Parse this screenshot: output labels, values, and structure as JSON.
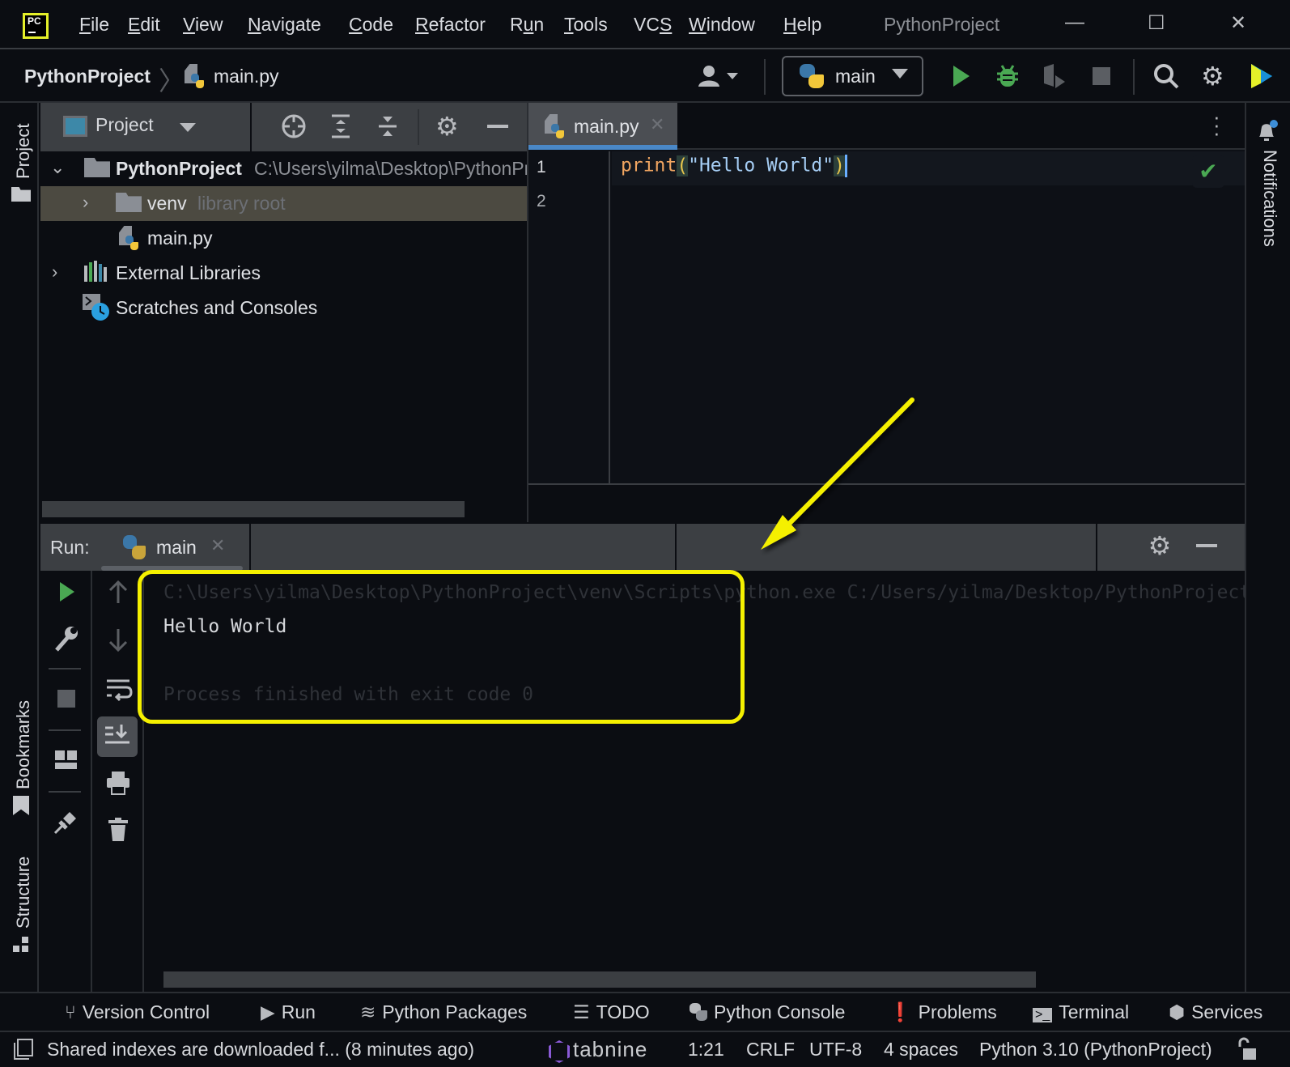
{
  "app": {
    "window_title": "PythonProject",
    "menu": [
      {
        "label": "File",
        "mnemonic": "F"
      },
      {
        "label": "Edit",
        "mnemonic": "E"
      },
      {
        "label": "View",
        "mnemonic": "V"
      },
      {
        "label": "Navigate",
        "mnemonic": "N"
      },
      {
        "label": "Code",
        "mnemonic": "C"
      },
      {
        "label": "Refactor",
        "mnemonic": "R"
      },
      {
        "label": "Run",
        "mnemonic": "u"
      },
      {
        "label": "Tools",
        "mnemonic": "T"
      },
      {
        "label": "VCS",
        "mnemonic": "S"
      },
      {
        "label": "Window",
        "mnemonic": "W"
      },
      {
        "label": "Help",
        "mnemonic": "H"
      }
    ],
    "window_controls": {
      "minimize": "—",
      "maximize": "☐",
      "close": "✕"
    }
  },
  "navbar": {
    "breadcrumb": [
      "PythonProject",
      "main.py"
    ],
    "run_config": "main",
    "icons": [
      "user-icon",
      "run-icon",
      "debug-icon",
      "coverage-icon",
      "stop-icon",
      "search-icon",
      "settings-icon",
      "jetbrains-icon"
    ]
  },
  "left_strip": {
    "top": [
      {
        "label": "Project",
        "icon": "folder-icon"
      }
    ],
    "bottom": [
      {
        "label": "Bookmarks",
        "icon": "bookmark-icon"
      },
      {
        "label": "Structure",
        "icon": "structure-icon"
      }
    ]
  },
  "project_panel": {
    "title": "Project",
    "tree": [
      {
        "label": "PythonProject",
        "sub": "C:\\Users\\yilma\\Desktop\\PythonProject",
        "expanded": true,
        "icon": "folder-icon",
        "bold": true
      },
      {
        "label": "venv",
        "sub": "library root",
        "expanded": false,
        "icon": "folder-icon",
        "selected": true
      },
      {
        "label": "main.py",
        "icon": "python-file-icon"
      },
      {
        "label": "External Libraries",
        "expanded": false,
        "icon": "library-icon"
      },
      {
        "label": "Scratches and Consoles",
        "icon": "scratches-icon"
      }
    ]
  },
  "editor": {
    "tab": "main.py",
    "line_numbers": [
      "1",
      "2"
    ],
    "code": {
      "func": "print",
      "open": "(",
      "string": "\"Hello World\"",
      "close": ")"
    },
    "inspection": "✔"
  },
  "right_strip": {
    "label": "Notifications"
  },
  "run_panel": {
    "label": "Run:",
    "tab": "main",
    "console": [
      "C:\\Users\\yilma\\Desktop\\PythonProject\\venv\\Scripts\\python.exe C:/Users/yilma/Desktop/PythonProject/main.py",
      "Hello World",
      "",
      "Process finished with exit code 0"
    ]
  },
  "tool_windows": [
    {
      "label": "Version Control",
      "icon": "vcs-icon"
    },
    {
      "label": "Run",
      "icon": "run-icon"
    },
    {
      "label": "Python Packages",
      "icon": "packages-icon"
    },
    {
      "label": "TODO",
      "icon": "todo-icon"
    },
    {
      "label": "Python Console",
      "icon": "python-console-icon"
    },
    {
      "label": "Problems",
      "icon": "problems-icon"
    },
    {
      "label": "Terminal",
      "icon": "terminal-icon"
    },
    {
      "label": "Services",
      "icon": "services-icon"
    }
  ],
  "statusbar": {
    "message": "Shared indexes are downloaded f... (8 minutes ago)",
    "plugin": "tabnine",
    "position": "1:21",
    "line_separator": "CRLF",
    "encoding": "UTF-8",
    "indent": "4 spaces",
    "interpreter": "Python 3.10 (PythonProject)"
  },
  "annotation": {
    "highlight_color": "#f5f000"
  }
}
